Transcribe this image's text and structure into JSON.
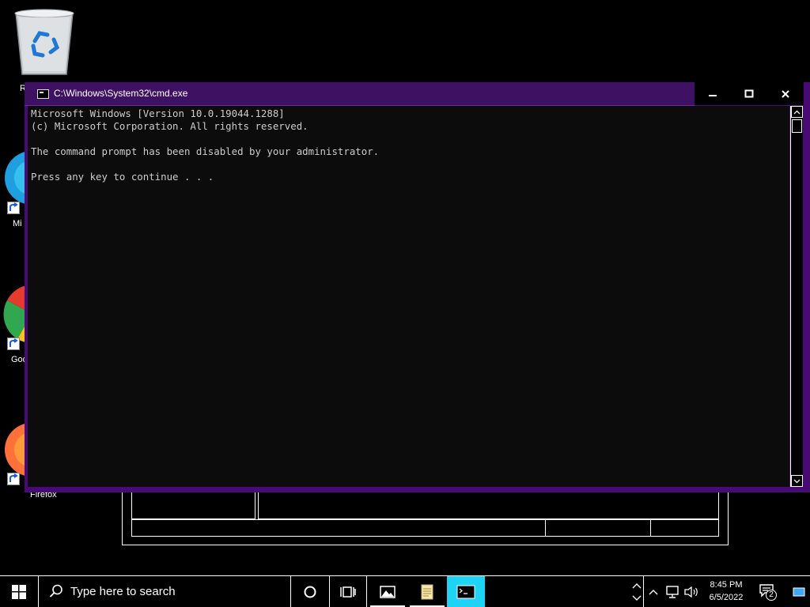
{
  "desktop": {
    "icons": [
      {
        "label": "R",
        "name": "recycle-bin"
      },
      {
        "label": "Mi",
        "name": "microsoft-edge"
      },
      {
        "label": "Goo",
        "name": "google-chrome"
      },
      {
        "label": "Firefox",
        "name": "firefox"
      }
    ]
  },
  "cmd": {
    "title": "C:\\Windows\\System32\\cmd.exe",
    "lines": [
      "Microsoft Windows [Version 10.0.19044.1288]",
      "(c) Microsoft Corporation. All rights reserved.",
      "",
      "The command prompt has been disabled by your administrator.",
      "",
      "Press any key to continue . . ."
    ],
    "colors": {
      "frame": "#480a73",
      "titlebar": "#3f1162",
      "console_bg": "#0c0c0c",
      "console_fg": "#cccccc"
    }
  },
  "taskbar": {
    "search_placeholder": "Type here to search",
    "clock_time": "8:45 PM",
    "clock_date": "6/5/2022",
    "notification_count": "2",
    "active_app_color": "#1fd3f7"
  }
}
